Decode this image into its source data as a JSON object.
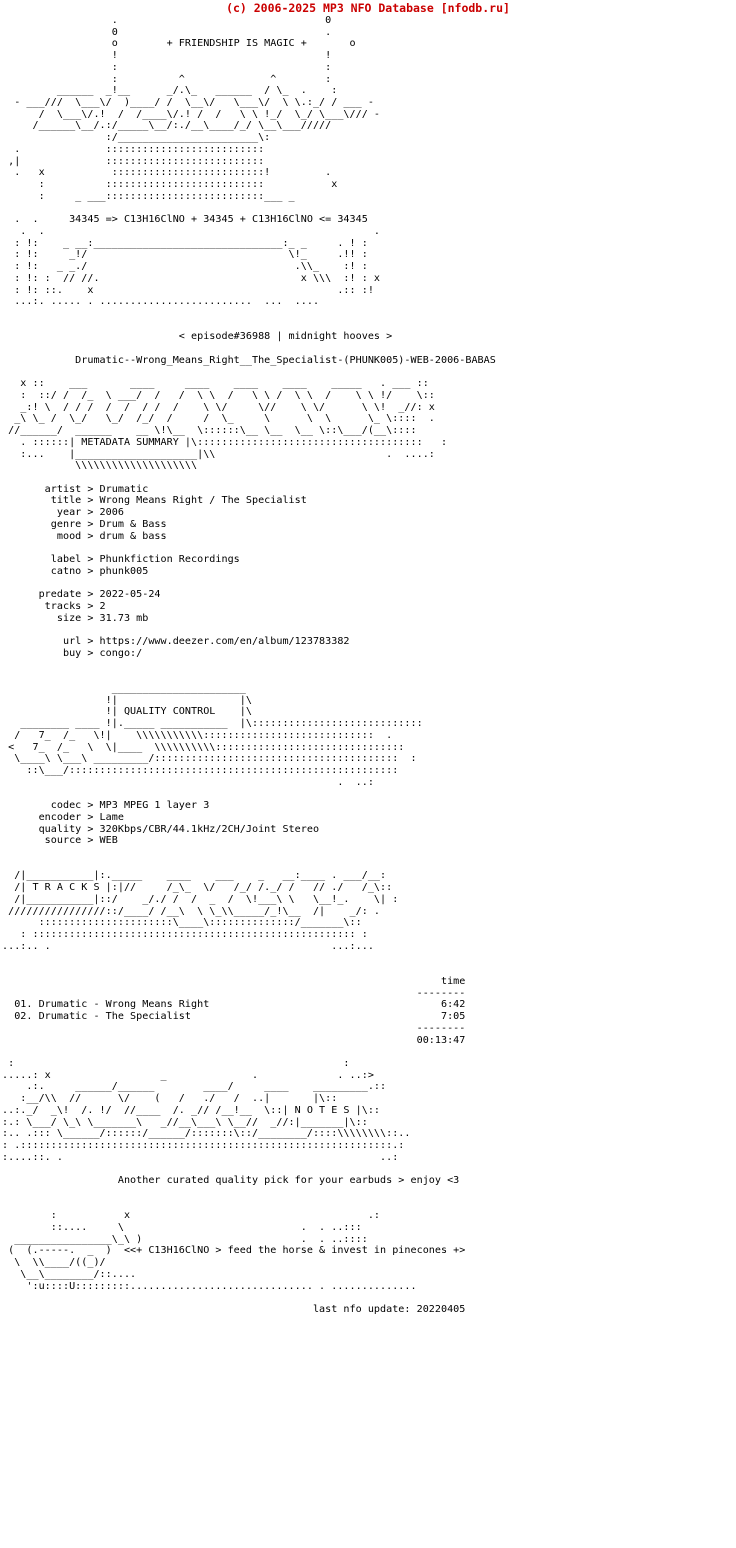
{
  "header": {
    "copyright": "(c) 2006-2025 MP3 NFO Database [nfodb.ru]",
    "copyright_color": "#ca0000"
  },
  "banner": {
    "tagline": "+ FRIENDSHIP IS MAGIC +",
    "formula": "34345 => C13H16ClNO + 34345 + C13H16ClNO <= 34345",
    "episode": "< episode#36988 | midnight hooves >",
    "release": "Drumatic--Wrong_Means_Right__The_Specialist-(PHUNK005)-WEB-2006-BABAS"
  },
  "sections": {
    "metadata_title": "METADATA SUMMARY",
    "quality_title": "QUALITY CONTROL",
    "tracks_title": "T R A C K S",
    "notes_title": "N O T E S"
  },
  "metadata": [
    {
      "key": "artist",
      "value": "Drumatic"
    },
    {
      "key": "title",
      "value": "Wrong Means Right / The Specialist"
    },
    {
      "key": "year",
      "value": "2006"
    },
    {
      "key": "genre",
      "value": "Drum & Bass"
    },
    {
      "key": "mood",
      "value": "drum & bass"
    },
    {
      "key": "label",
      "value": "Phunkfiction Recordings"
    },
    {
      "key": "catno",
      "value": "phunk005"
    },
    {
      "key": "predate",
      "value": "2022-05-24"
    },
    {
      "key": "tracks",
      "value": "2"
    },
    {
      "key": "size",
      "value": "31.73 mb"
    },
    {
      "key": "url",
      "value": "https://www.deezer.com/en/album/123783382"
    },
    {
      "key": "buy",
      "value": "congo:/"
    }
  ],
  "quality": [
    {
      "key": "codec",
      "value": "MP3 MPEG 1 layer 3"
    },
    {
      "key": "encoder",
      "value": "Lame"
    },
    {
      "key": "quality",
      "value": "320Kbps/CBR/44.1kHz/2CH/Joint Stereo"
    },
    {
      "key": "source",
      "value": "WEB"
    }
  ],
  "tracklist": {
    "time_header": "time",
    "rule": "--------",
    "items": [
      {
        "num": "01.",
        "artist": "Drumatic",
        "title": "Wrong Means Right",
        "time": "6:42"
      },
      {
        "num": "02.",
        "artist": "Drumatic",
        "title": "The Specialist",
        "time": "7:05"
      }
    ],
    "total": "00:13:47"
  },
  "notes": {
    "text": "Another curated quality pick for your earbuds > enjoy <3"
  },
  "footer": {
    "tagline": "<<+ C13H16ClNO > feed the horse & invest in pinecones +>",
    "last_update": "last nfo update: 20220405"
  },
  "ascii": {
    "block_top": "                  .                               0\n                  0                               .\n                  o               + FRIENDSHIP IS MAGIC +         o\n                  !                               !\n                  :                               :\n                  :              ^                :\n        ______  __!__)  __/.\\__   ______  __/^\\_   :__/.\n - ___///  \\___\\/.  ) _/   \\ \\  /  \\___\\/   / \\ \\ ./ _/ / .___ -\n    /_______\\!  //  /______\\!  /_/   \\ \\___\\/  /////\n   /________/::/___________\\.:::::/________\\:::\n           :::::::::::::::::::::::::::::::::::\n           :::::::::::::::::::::::::::::::::::\n            ::::::::::::::::::::::::::::::::::!\n           :::::::::::::::::::::::::::::::::::\n           :::::::::::::::::::::::::::::::::::\n  .   _ ___:::::::::::::::::::::::::::::::::::___ _\n"
  }
}
